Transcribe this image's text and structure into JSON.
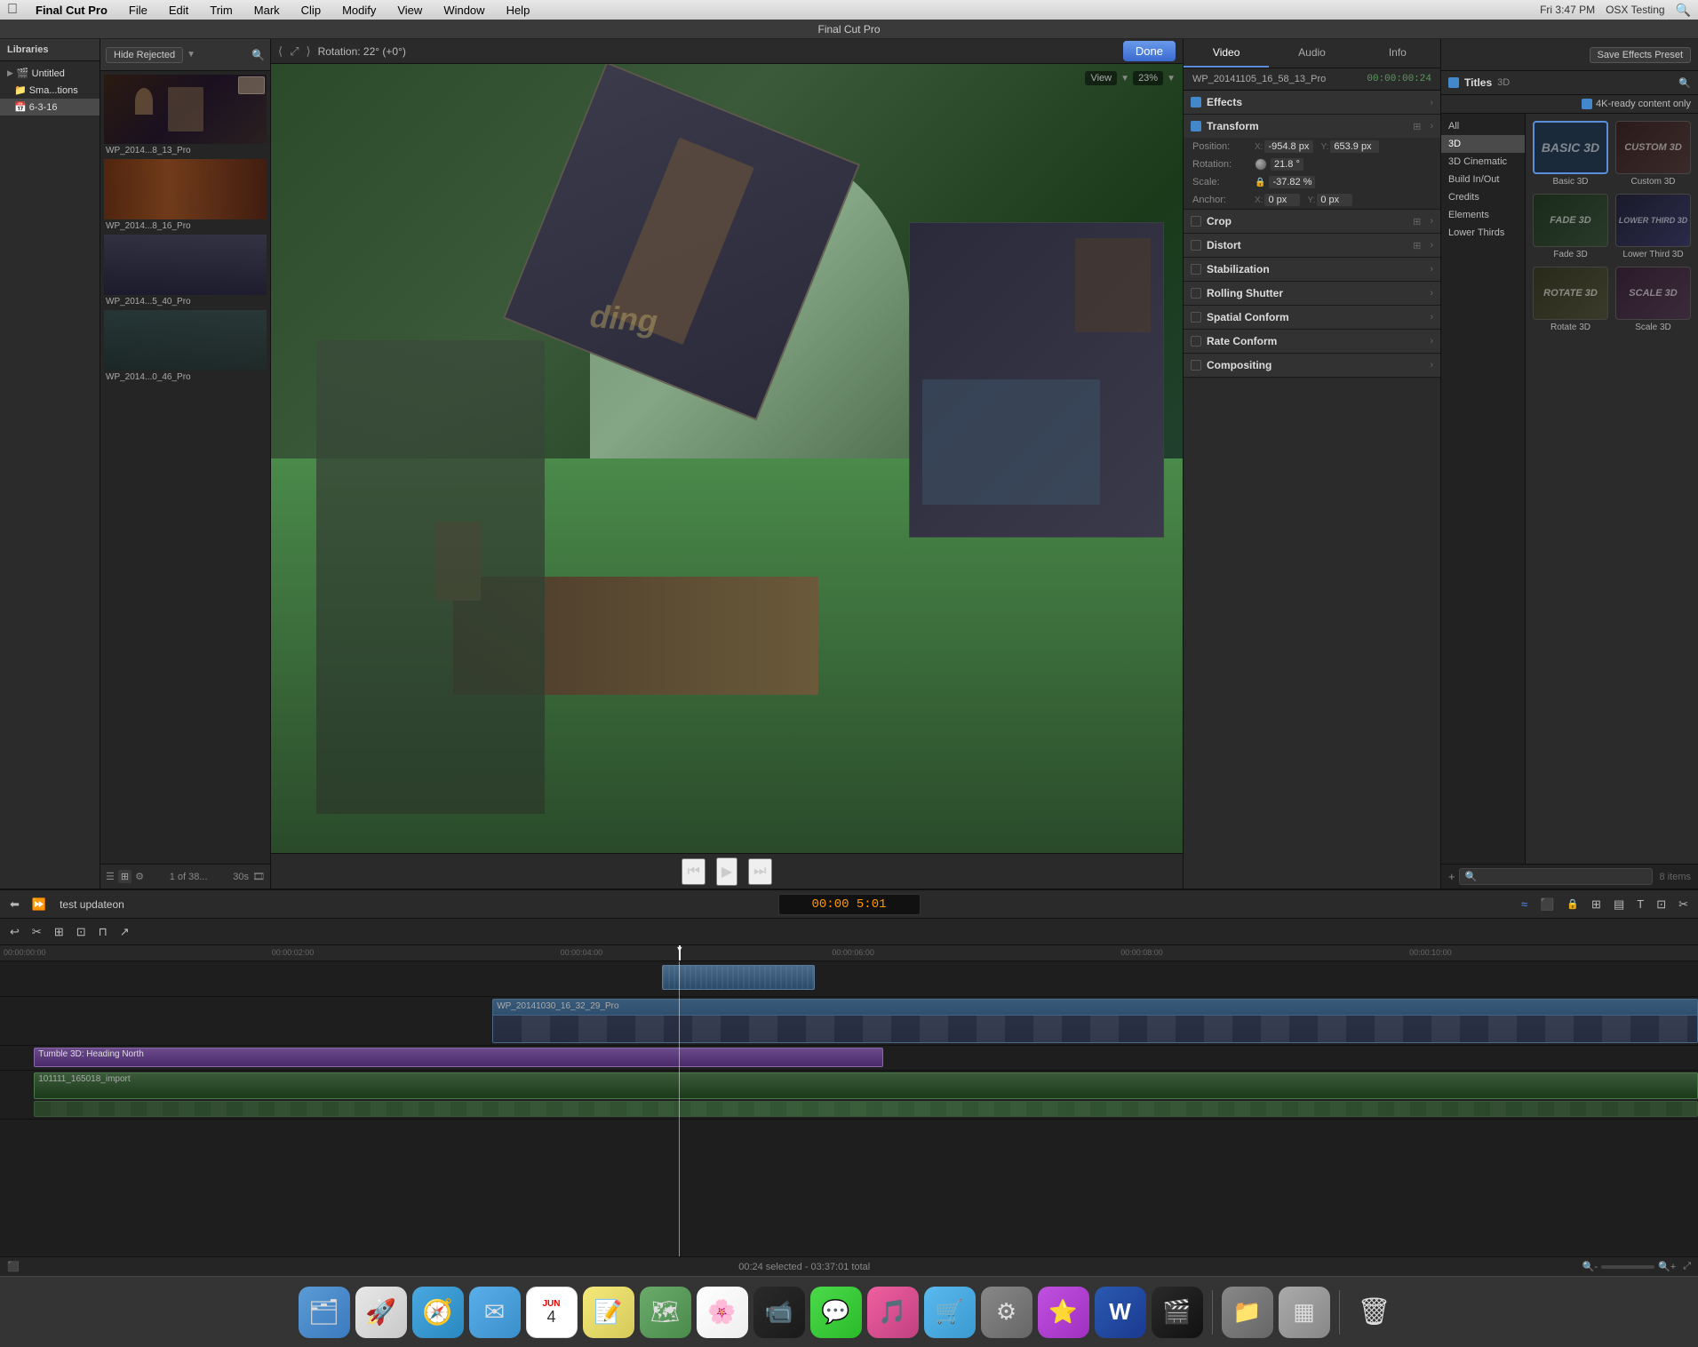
{
  "app": {
    "name": "Final Cut Pro",
    "window_title": "Final Cut Pro",
    "time": "Fri 3:47 PM",
    "user": "OSX Testing"
  },
  "menubar": {
    "apple": "🍎",
    "items": [
      "Final Cut Pro",
      "File",
      "Edit",
      "Trim",
      "Mark",
      "Clip",
      "Modify",
      "View",
      "Window",
      "Help"
    ]
  },
  "library": {
    "label": "Libraries",
    "items": [
      {
        "label": "Untitled",
        "type": "library",
        "icon": "▶"
      },
      {
        "label": "Sma...tions",
        "type": "folder",
        "icon": "▸"
      },
      {
        "label": "6-3-16",
        "type": "event",
        "icon": "▸"
      }
    ]
  },
  "browser": {
    "filter_label": "Hide Rejected",
    "clip_count": "1 of 38...",
    "duration": "30s",
    "clips": [
      {
        "label": "WP_2014...8_13_Pro",
        "thumb_color": "#2a1a10"
      },
      {
        "label": "WP_2014...8_16_Pro",
        "thumb_color": "#3a1a10"
      },
      {
        "label": "WP_2014...5_40_Pro",
        "thumb_color": "#1a1a2a"
      },
      {
        "label": "WP_2014...0_46_Pro",
        "thumb_color": "#1a2a2a"
      }
    ]
  },
  "viewer": {
    "rotation": "Rotation: 22° (+0°)",
    "zoom": "23%",
    "done_label": "Done"
  },
  "inspector": {
    "tabs": [
      "Video",
      "Audio",
      "Info"
    ],
    "active_tab": "Video",
    "clip_name": "WP_20141105_16_58_13_Pro",
    "clip_time": "00:00:00:24",
    "effects_label": "Effects",
    "transform": {
      "label": "Transform",
      "position": {
        "x": "-954.8 px",
        "y": "653.9 px"
      },
      "rotation": "21.8 °",
      "scale": "-37.82 %",
      "anchor": {
        "x": "0 px",
        "y": "0 px"
      }
    },
    "crop_label": "Crop",
    "distort_label": "Distort",
    "stabilization_label": "Stabilization",
    "rolling_shutter_label": "Rolling Shutter",
    "spatial_conform_label": "Spatial Conform",
    "rate_conform_label": "Rate Conform",
    "compositing_label": "Compositing"
  },
  "titles_panel": {
    "header": "Titles",
    "badge": "3D",
    "filter_label": "4K-ready content only",
    "categories": [
      "All",
      "3D",
      "3D Cinematic",
      "Build In/Out",
      "Credits",
      "Elements",
      "Lower Thirds"
    ],
    "active_category": "3D",
    "items": [
      {
        "id": "basic3d",
        "label": "Basic 3D",
        "selected": true
      },
      {
        "id": "custom3d",
        "label": "Custom 3D",
        "selected": false
      },
      {
        "id": "fade3d",
        "label": "Fade 3D",
        "selected": false
      },
      {
        "id": "lower3rd",
        "label": "Lower Third 3D",
        "selected": false
      },
      {
        "id": "rotate3d",
        "label": "Rotate 3D",
        "selected": false
      },
      {
        "id": "scale3d",
        "label": "Scale 3D",
        "selected": false
      }
    ],
    "count": "8 items",
    "save_effects_label": "Save Effects Preset"
  },
  "timeline": {
    "project_name": "test updateon",
    "timecode": "00:00  5:01",
    "status": "00:24 selected - 03:37:01 total",
    "ruler_marks": [
      "00:00:00:00",
      "00:00:02:00",
      "00:00:04:00",
      "00:00:06:00",
      "00:00:08:00",
      "00:00:10:00"
    ],
    "tracks": [
      {
        "id": "connected",
        "label": "WP_20141030_16_32_29_Pro",
        "type": "main_clip"
      },
      {
        "id": "effect",
        "label": "Tumble 3D: Heading North",
        "type": "effect"
      },
      {
        "id": "base",
        "label": "101111_165018_import",
        "type": "base_clip"
      }
    ]
  },
  "dock": {
    "items": [
      {
        "name": "finder",
        "icon": "🗂",
        "label": "Finder"
      },
      {
        "name": "launchpad",
        "icon": "🚀",
        "label": "Launchpad"
      },
      {
        "name": "safari",
        "icon": "🧭",
        "label": "Safari"
      },
      {
        "name": "mail",
        "icon": "✉",
        "label": "Mail"
      },
      {
        "name": "calendar",
        "icon": "📅",
        "label": "Calendar"
      },
      {
        "name": "notes",
        "icon": "📝",
        "label": "Notes"
      },
      {
        "name": "maps",
        "icon": "🗺",
        "label": "Maps"
      },
      {
        "name": "photos",
        "icon": "🖼",
        "label": "Photos"
      },
      {
        "name": "facetime",
        "icon": "📹",
        "label": "FaceTime"
      },
      {
        "name": "messages",
        "icon": "💬",
        "label": "Messages"
      },
      {
        "name": "itunes",
        "icon": "🎵",
        "label": "iTunes"
      },
      {
        "name": "appstore",
        "icon": "🛒",
        "label": "App Store"
      },
      {
        "name": "sysprefs",
        "icon": "⚙",
        "label": "System Preferences"
      },
      {
        "name": "ilife",
        "icon": "⭐",
        "label": "iLife"
      },
      {
        "name": "word",
        "icon": "W",
        "label": "Word"
      },
      {
        "name": "fcpx",
        "icon": "🎬",
        "label": "Final Cut Pro"
      },
      {
        "name": "finder2",
        "icon": "📁",
        "label": "Finder"
      },
      {
        "name": "app1",
        "icon": "▦",
        "label": "App"
      },
      {
        "name": "trash",
        "icon": "🗑",
        "label": "Trash"
      }
    ]
  }
}
